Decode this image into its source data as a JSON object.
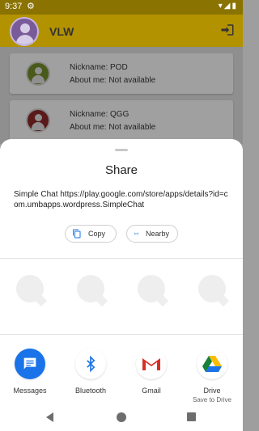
{
  "status_bar": {
    "time": "9:37"
  },
  "app_bar": {
    "title": "VLW"
  },
  "contacts": [
    {
      "nickname": "Nickname: POD",
      "about": "About me: Not available",
      "avatar_color": "#4a5a1a"
    },
    {
      "nickname": "Nickname: QGG",
      "about": "About me: Not available",
      "avatar_color": "#5a1a1a"
    }
  ],
  "share_sheet": {
    "title": "Share",
    "text": "Simple Chat https://play.google.com/store/apps/details?id=com.umbapps.wordpress.SimpleChat",
    "copy_label": "Copy",
    "nearby_label": "Nearby",
    "apps": [
      {
        "label": "Messages",
        "sub": ""
      },
      {
        "label": "Bluetooth",
        "sub": ""
      },
      {
        "label": "Gmail",
        "sub": ""
      },
      {
        "label": "Drive",
        "sub": "Save to Drive"
      }
    ]
  },
  "colors": {
    "app_bar": "#b39200",
    "status_bar": "#8a7300",
    "accent": "#1a73e8"
  }
}
